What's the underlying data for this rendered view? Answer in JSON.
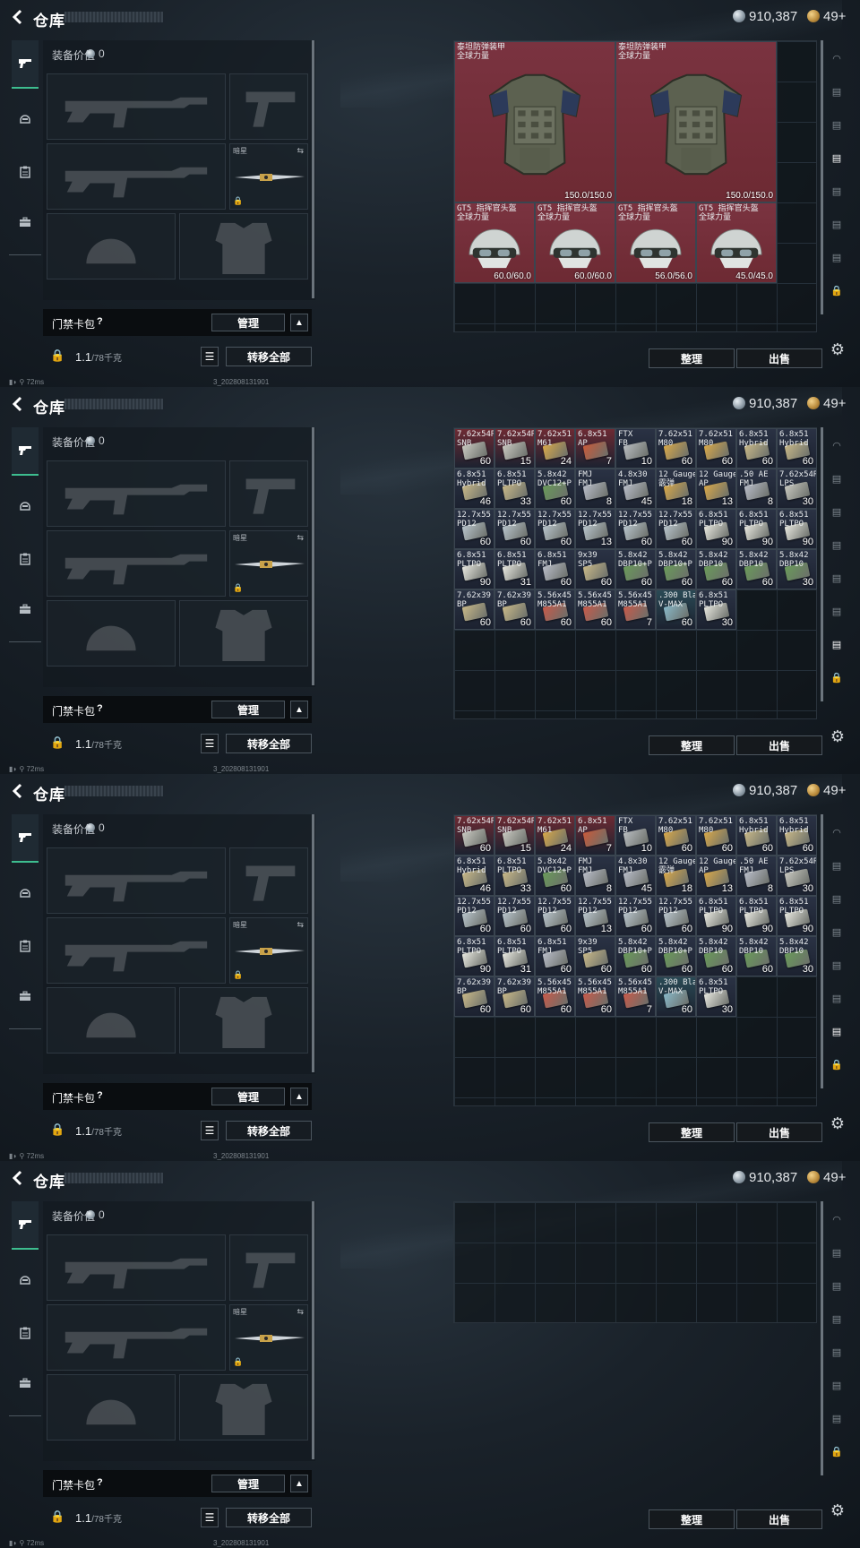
{
  "header": {
    "title": "仓库",
    "money": "910,387",
    "tickets": "49+"
  },
  "equipment": {
    "value_label": "装备价值",
    "value": "0",
    "knife_label": "暗星",
    "card_label": "门禁卡包",
    "card_help": "?",
    "manage_label": "管理",
    "weight": "1.1",
    "weight_max": "/78千克",
    "transfer_label": "转移全部"
  },
  "status": {
    "ping": "72ms",
    "build": "3_202808131901"
  },
  "stash": {
    "sort_label": "整理",
    "sell_label": "出售"
  },
  "frame1_items": [
    {
      "name": "泰坦防弹装甲\n全球力量",
      "count": "150.0/150.0",
      "kind": "armor",
      "col": 0,
      "row": 0,
      "w": 4,
      "h": 4
    },
    {
      "name": "泰坦防弹装甲\n全球力量",
      "count": "150.0/150.0",
      "kind": "armor",
      "col": 4,
      "row": 0,
      "w": 4,
      "h": 4
    },
    {
      "name": "GT5 指挥官头盔\n全球力量",
      "count": "60.0/60.0",
      "kind": "helmet",
      "col": 0,
      "row": 4,
      "w": 2,
      "h": 2
    },
    {
      "name": "GT5 指挥官头盔\n全球力量",
      "count": "60.0/60.0",
      "kind": "helmet",
      "col": 2,
      "row": 4,
      "w": 2,
      "h": 2
    },
    {
      "name": "GT5 指挥官头盔\n全球力量",
      "count": "56.0/56.0",
      "kind": "helmet",
      "col": 4,
      "row": 4,
      "w": 2,
      "h": 2
    },
    {
      "name": "GT5 指挥官头盔\n全球力量",
      "count": "45.0/45.0",
      "kind": "helmet",
      "col": 6,
      "row": 4,
      "w": 2,
      "h": 2
    }
  ],
  "ammo_items": [
    {
      "name": "7.62x54R\nSNB",
      "count": "60",
      "tone": "red",
      "box": "#c8c8c0"
    },
    {
      "name": "7.62x54R\nSNB",
      "count": "15",
      "tone": "red",
      "box": "#c8c8c0"
    },
    {
      "name": "7.62x51\nM61",
      "count": "24",
      "tone": "red",
      "box": "#d8a84a"
    },
    {
      "name": "6.8x51\nAP",
      "count": "7",
      "tone": "red",
      "box": "#c85a3a"
    },
    {
      "name": "FTX\nFB",
      "count": "10",
      "tone": "blue",
      "box": "#b8bcc0"
    },
    {
      "name": "7.62x51\nM80",
      "count": "60",
      "tone": "blue",
      "box": "#d8a84a"
    },
    {
      "name": "7.62x51\nM80",
      "count": "60",
      "tone": "blue",
      "box": "#d8a84a"
    },
    {
      "name": "6.8x51\nHybrid",
      "count": "60",
      "tone": "blue",
      "box": "#c8b888"
    },
    {
      "name": "6.8x51\nHybrid",
      "count": "60",
      "tone": "blue",
      "box": "#c8b888"
    },
    {
      "name": "6.8x51\nHybrid",
      "count": "46",
      "tone": "blue",
      "box": "#c8b888"
    },
    {
      "name": "6.8x51\nPLTPO",
      "count": "33",
      "tone": "blue",
      "box": "#c8b888"
    },
    {
      "name": "5.8x42\nDVC12+P",
      "count": "60",
      "tone": "blue",
      "box": "#6a9a5a"
    },
    {
      "name": "FMJ\nFMJ",
      "count": "8",
      "tone": "blue",
      "box": "#b8bcc8"
    },
    {
      "name": "4.8x30\nFMJ",
      "count": "45",
      "tone": "blue",
      "box": "#b8bcc8"
    },
    {
      "name": "12 Gauge\n霰弹",
      "count": "18",
      "tone": "blue",
      "box": "#d8a84a"
    },
    {
      "name": "12 Gauge\nAP",
      "count": "13",
      "tone": "blue",
      "box": "#d8a84a"
    },
    {
      "name": ".50 AE\nFMJ",
      "count": "8",
      "tone": "blue",
      "box": "#b8bcc8"
    },
    {
      "name": "7.62x54R\nLPS",
      "count": "30",
      "tone": "blue",
      "box": "#c8c8c0"
    },
    {
      "name": "12.7x55\nPD12",
      "count": "60",
      "tone": "blue",
      "box": "#b8c4cc"
    },
    {
      "name": "12.7x55\nPD12",
      "count": "60",
      "tone": "blue",
      "box": "#b8c4cc"
    },
    {
      "name": "12.7x55\nPD12",
      "count": "60",
      "tone": "blue",
      "box": "#b8c4cc"
    },
    {
      "name": "12.7x55\nPD12",
      "count": "13",
      "tone": "blue",
      "box": "#b8c4cc"
    },
    {
      "name": "12.7x55\nPD12",
      "count": "60",
      "tone": "blue",
      "box": "#b8c4cc"
    },
    {
      "name": "12.7x55\nPD12",
      "count": "60",
      "tone": "blue",
      "box": "#b8c4cc"
    },
    {
      "name": "6.8x51\nPLTPO",
      "count": "90",
      "tone": "blue",
      "box": "#e8e8e0"
    },
    {
      "name": "6.8x51\nPLTPO",
      "count": "90",
      "tone": "blue",
      "box": "#e8e8e0"
    },
    {
      "name": "6.8x51\nPLTPO",
      "count": "90",
      "tone": "blue",
      "box": "#e8e8e0"
    },
    {
      "name": "6.8x51\nPLTPO",
      "count": "90",
      "tone": "blue",
      "box": "#e8e8e0"
    },
    {
      "name": "6.8x51\nPLTPO",
      "count": "31",
      "tone": "blue",
      "box": "#e8e8e0"
    },
    {
      "name": "6.8x51\nFMJ",
      "count": "60",
      "tone": "blue",
      "box": "#b8bcc8"
    },
    {
      "name": "9x39\nSP5",
      "count": "60",
      "tone": "blue",
      "box": "#c8b888"
    },
    {
      "name": "5.8x42\nDBP10+P",
      "count": "60",
      "tone": "blue",
      "box": "#6a9a5a"
    },
    {
      "name": "5.8x42\nDBP10+P",
      "count": "60",
      "tone": "blue",
      "box": "#6a9a5a"
    },
    {
      "name": "5.8x42\nDBP10",
      "count": "60",
      "tone": "blue",
      "box": "#6a9a5a"
    },
    {
      "name": "5.8x42\nDBP10",
      "count": "60",
      "tone": "blue",
      "box": "#6a9a5a"
    },
    {
      "name": "5.8x42\nDBP10",
      "count": "30",
      "tone": "blue",
      "box": "#6a9a5a"
    },
    {
      "name": "7.62x39\nBP",
      "count": "60",
      "tone": "blue",
      "box": "#c8b888"
    },
    {
      "name": "7.62x39\nBP",
      "count": "60",
      "tone": "blue",
      "box": "#c8b888"
    },
    {
      "name": "5.56x45\nM855A1",
      "count": "60",
      "tone": "blue",
      "box": "#c85a4a"
    },
    {
      "name": "5.56x45\nM855A1",
      "count": "60",
      "tone": "blue",
      "box": "#c85a4a"
    },
    {
      "name": "5.56x45\nM855A1",
      "count": "7",
      "tone": "blue",
      "box": "#c85a4a"
    },
    {
      "name": ".300 Bla\nV-MAX",
      "count": "60",
      "tone": "teal",
      "box": "#88b8c8"
    },
    {
      "name": "6.8x51\nPLTPO",
      "count": "30",
      "tone": "blue",
      "box": "#e8e8e0"
    }
  ],
  "colors": {
    "accent": "#3dbd8f",
    "red_slot": "#6d2a33",
    "blue_slot": "#2a3244",
    "teal_slot": "#2a4a55"
  },
  "left_nav_icons": [
    "pistol-icon",
    "helmet-icon",
    "clipboard-icon",
    "briefcase-icon"
  ],
  "right_nav_icons": [
    "bunker-icon",
    "crate-icon",
    "crate-icon",
    "crate-icon",
    "crate-icon",
    "crate-icon",
    "crate-icon",
    "lock-icon"
  ]
}
